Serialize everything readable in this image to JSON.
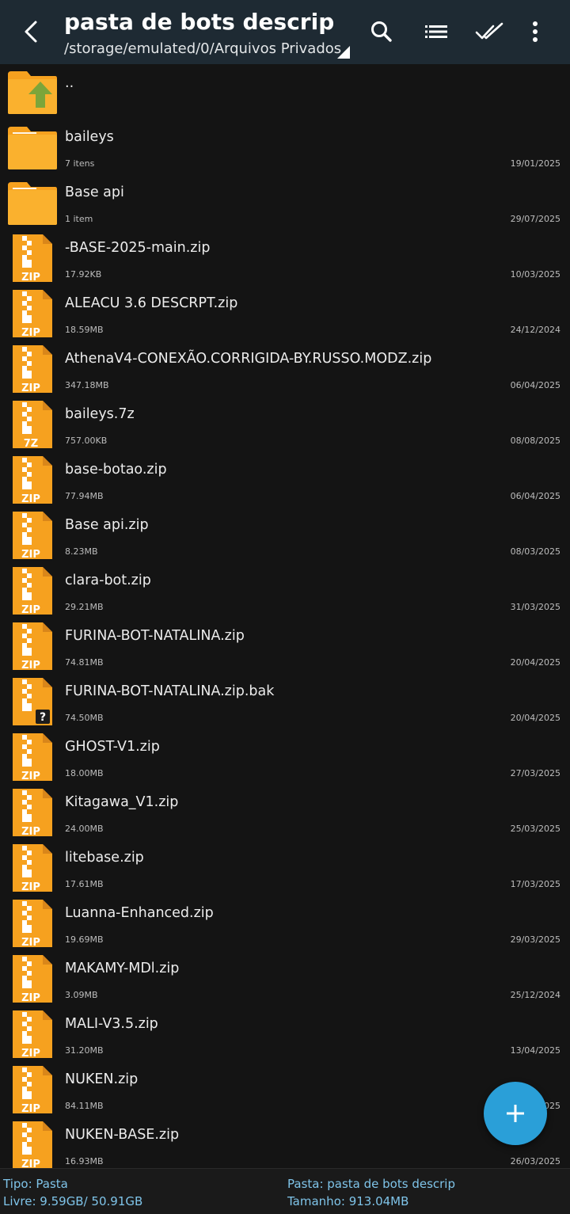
{
  "header": {
    "title": "pasta de bots descrip",
    "path": "/storage/emulated/0/Arquivos Privados"
  },
  "colors": {
    "toolbar": "#1e2a33",
    "background": "#141414",
    "folder": "#f6a11f",
    "fab": "#2a9fd8",
    "status_text": "#7fc4e9"
  },
  "parent_entry": {
    "label": "..",
    "icon": "folder-up-icon"
  },
  "items": [
    {
      "kind": "folder",
      "name": "baileys",
      "size": "7 itens",
      "date": "19/01/2025"
    },
    {
      "kind": "folder",
      "name": "Base api",
      "size": "1 item",
      "date": "29/07/2025"
    },
    {
      "kind": "zip",
      "badge": "ZIP",
      "name": "-BASE-2025-main.zip",
      "size": "17.92KB",
      "date": "10/03/2025"
    },
    {
      "kind": "zip",
      "badge": "ZIP",
      "name": "ALEACU 3.6 DESCRPT.zip",
      "size": "18.59MB",
      "date": "24/12/2024"
    },
    {
      "kind": "zip",
      "badge": "ZIP",
      "name": "AthenaV4-CONEXÃO.CORRIGIDA-BY.RUSSO.MODZ.zip",
      "size": "347.18MB",
      "date": "06/04/2025"
    },
    {
      "kind": "zip",
      "badge": "7Z",
      "name": "baileys.7z",
      "size": "757.00KB",
      "date": "08/08/2025"
    },
    {
      "kind": "zip",
      "badge": "ZIP",
      "name": "base-botao.zip",
      "size": "77.94MB",
      "date": "06/04/2025"
    },
    {
      "kind": "zip",
      "badge": "ZIP",
      "name": "Base api.zip",
      "size": "8.23MB",
      "date": "08/03/2025"
    },
    {
      "kind": "zip",
      "badge": "ZIP",
      "name": "clara-bot.zip",
      "size": "29.21MB",
      "date": "31/03/2025"
    },
    {
      "kind": "zip",
      "badge": "ZIP",
      "name": "FURINA-BOT-NATALINA.zip",
      "size": "74.81MB",
      "date": "20/04/2025"
    },
    {
      "kind": "unknown",
      "badge": "?",
      "name": "FURINA-BOT-NATALINA.zip.bak",
      "size": "74.50MB",
      "date": "20/04/2025"
    },
    {
      "kind": "zip",
      "badge": "ZIP",
      "name": "GHOST-V1.zip",
      "size": "18.00MB",
      "date": "27/03/2025"
    },
    {
      "kind": "zip",
      "badge": "ZIP",
      "name": "Kitagawa_V1.zip",
      "size": "24.00MB",
      "date": "25/03/2025"
    },
    {
      "kind": "zip",
      "badge": "ZIP",
      "name": "litebase.zip",
      "size": "17.61MB",
      "date": "17/03/2025"
    },
    {
      "kind": "zip",
      "badge": "ZIP",
      "name": "Luanna-Enhanced.zip",
      "size": "19.69MB",
      "date": "29/03/2025"
    },
    {
      "kind": "zip",
      "badge": "ZIP",
      "name": "MAKAMY-MDl.zip",
      "size": "3.09MB",
      "date": "25/12/2024"
    },
    {
      "kind": "zip",
      "badge": "ZIP",
      "name": "MALI-V3.5.zip",
      "size": "31.20MB",
      "date": "13/04/2025"
    },
    {
      "kind": "zip",
      "badge": "ZIP",
      "name": "NUKEN.zip",
      "size": "84.11MB",
      "date": "025"
    },
    {
      "kind": "zip",
      "badge": "ZIP",
      "name": "NUKEN-BASE.zip",
      "size": "16.93MB",
      "date": "26/03/2025"
    }
  ],
  "status": {
    "type": "Tipo: Pasta",
    "free": "Livre: 9.59GB/ 50.91GB",
    "folder": "Pasta: pasta de bots descrip",
    "size": "Tamanho: 913.04MB"
  }
}
